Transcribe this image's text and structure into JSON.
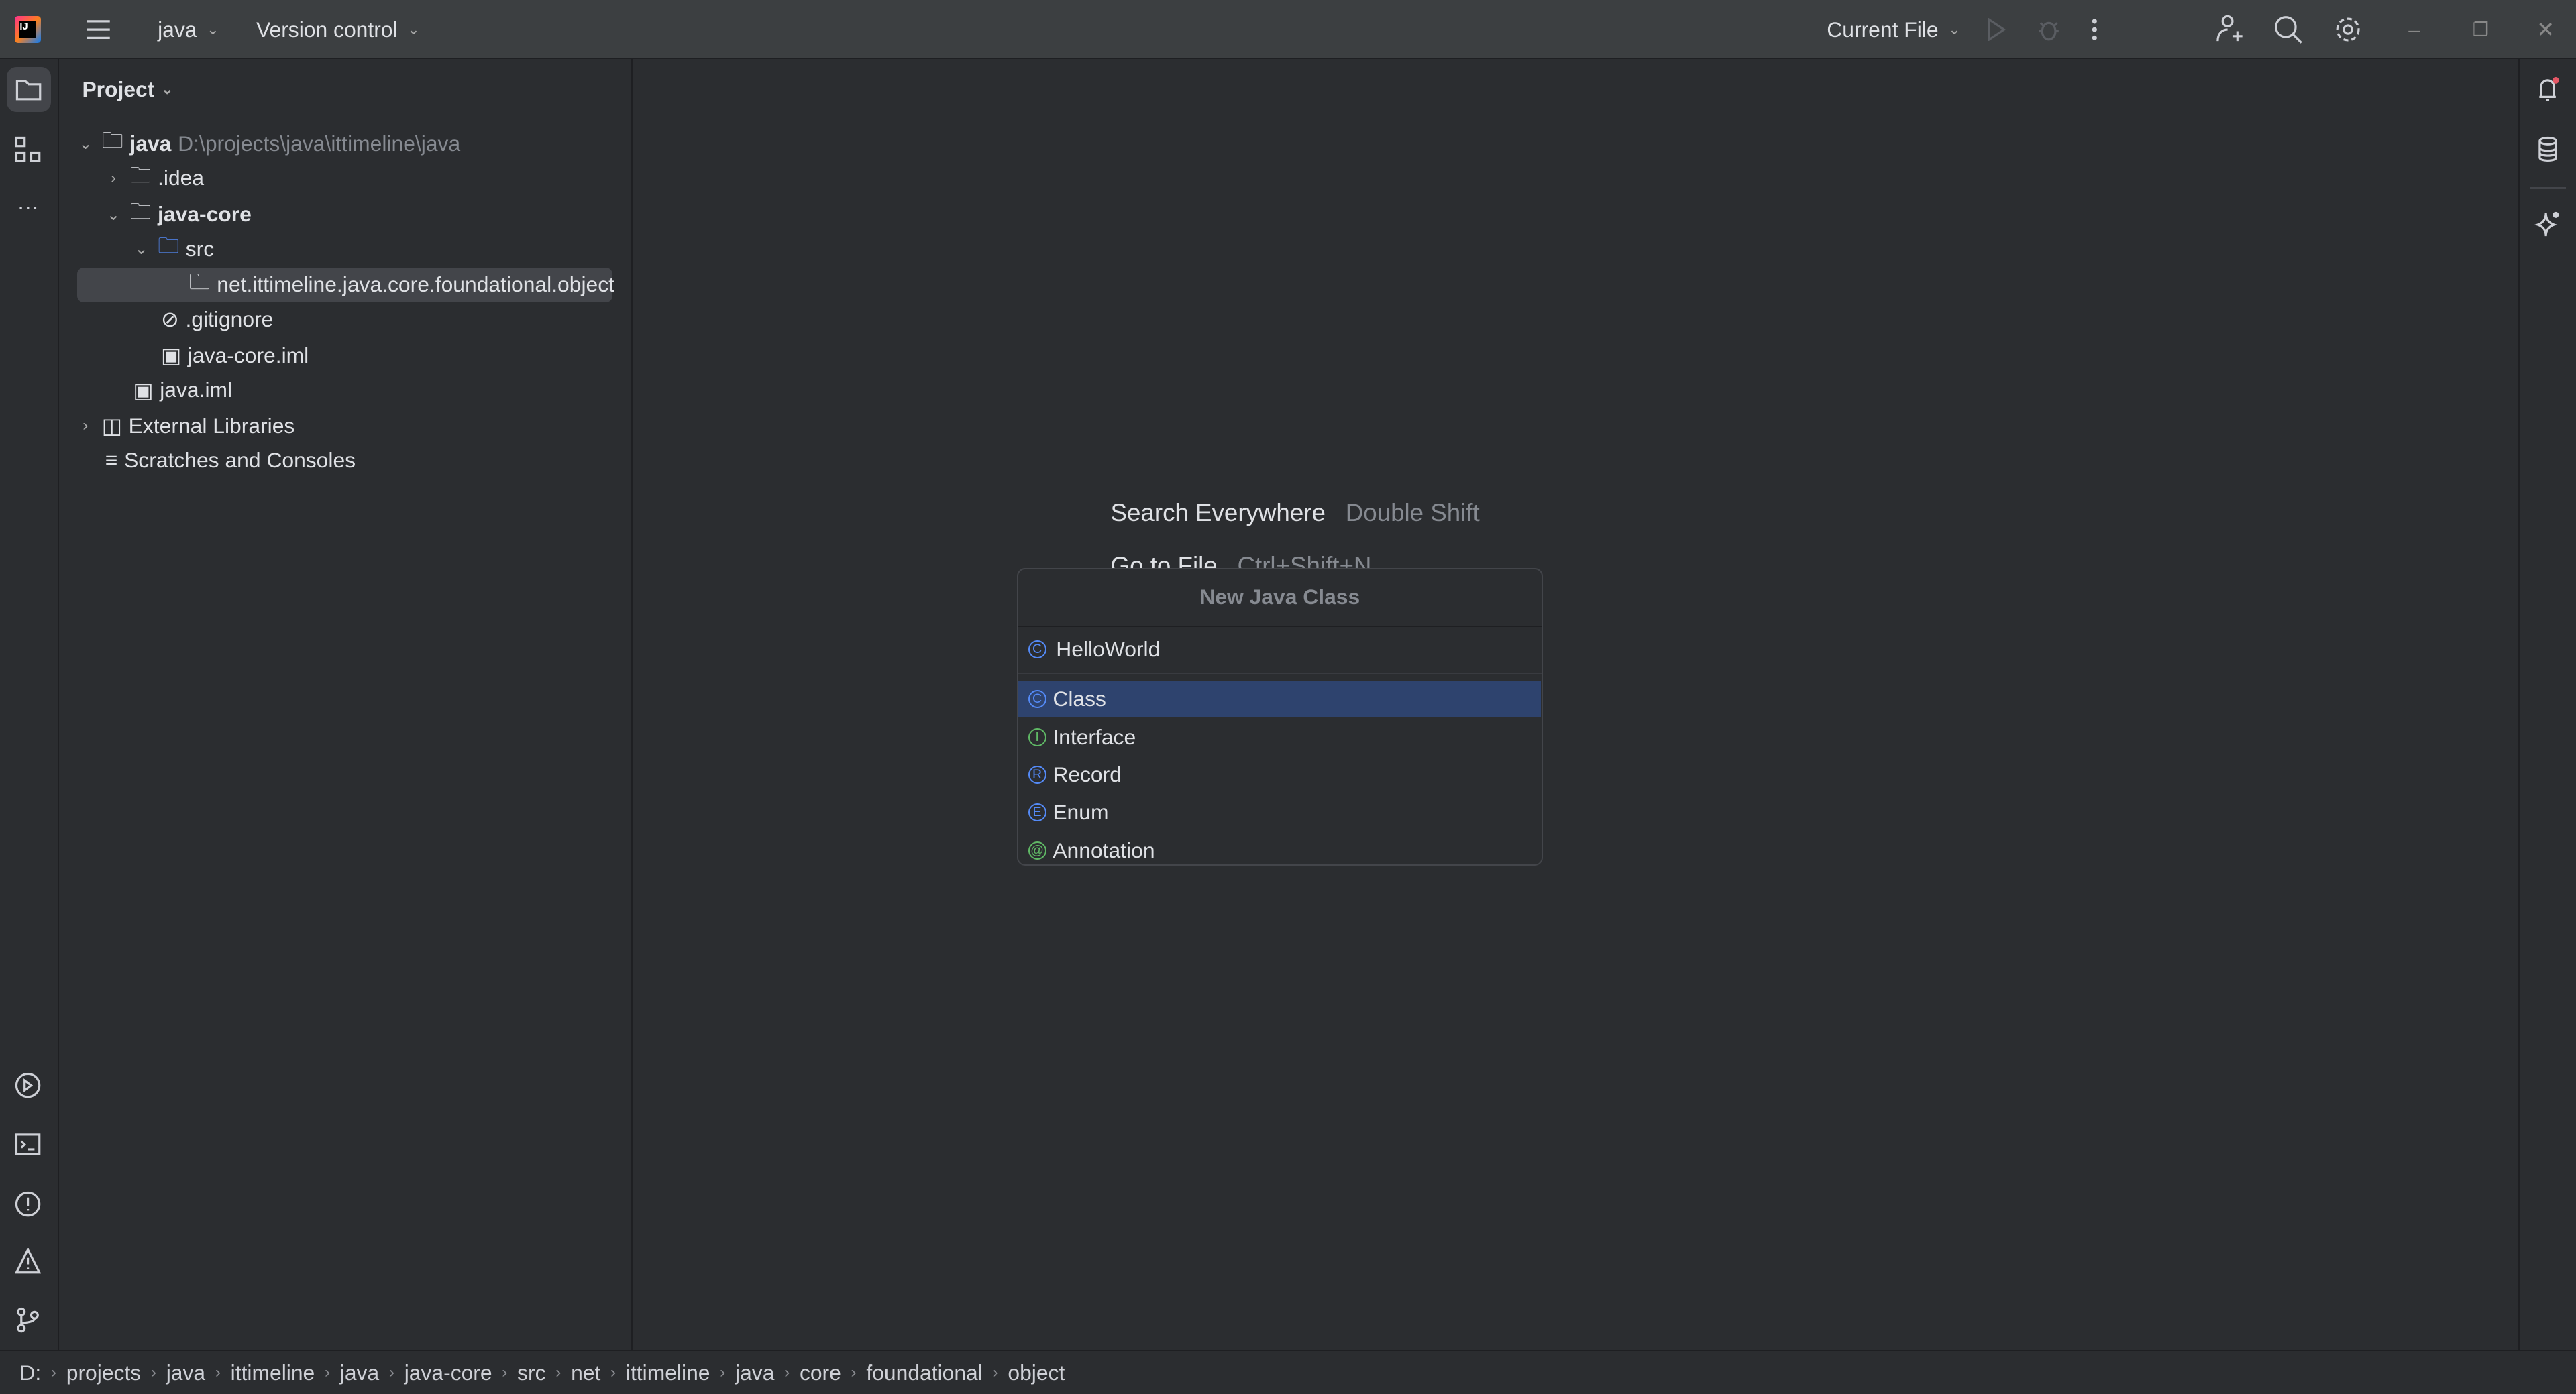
{
  "titlebar": {
    "project": "java",
    "vcs": "Version control",
    "run_config": "Current File"
  },
  "project_panel": {
    "title": "Project",
    "tree": [
      {
        "label": "java",
        "path": "D:\\projects\\java\\ittimeline\\java",
        "bold": true
      },
      {
        "label": ".idea"
      },
      {
        "label": "java-core",
        "bold": true
      },
      {
        "label": "src"
      },
      {
        "label": "net.ittimeline.java.core.foundational.object",
        "selected": true
      },
      {
        "label": ".gitignore"
      },
      {
        "label": "java-core.iml"
      },
      {
        "label": "java.iml"
      },
      {
        "label": "External Libraries"
      },
      {
        "label": "Scratches and Consoles"
      }
    ]
  },
  "editor": {
    "hint1_label": "Search Everywhere",
    "hint1_key": "Double Shift",
    "hint2_label": "Go to File",
    "hint2_key": "Ctrl+Shift+N"
  },
  "popup": {
    "title": "New Java Class",
    "input_value": "HelloWorld",
    "options": [
      {
        "label": "Class",
        "glyph": "C",
        "color": "#548af7"
      },
      {
        "label": "Interface",
        "glyph": "I",
        "color": "#5fb865"
      },
      {
        "label": "Record",
        "glyph": "R",
        "color": "#548af7"
      },
      {
        "label": "Enum",
        "glyph": "E",
        "color": "#548af7"
      },
      {
        "label": "Annotation",
        "glyph": "@",
        "color": "#5fb865"
      }
    ],
    "selected": "Class"
  },
  "breadcrumb": [
    "D:",
    "projects",
    "java",
    "ittimeline",
    "java",
    "java-core",
    "src",
    "net",
    "ittimeline",
    "java",
    "core",
    "foundational",
    "object"
  ],
  "colors": {
    "accent": "#2e436e",
    "notification_dot": "#e55765"
  }
}
